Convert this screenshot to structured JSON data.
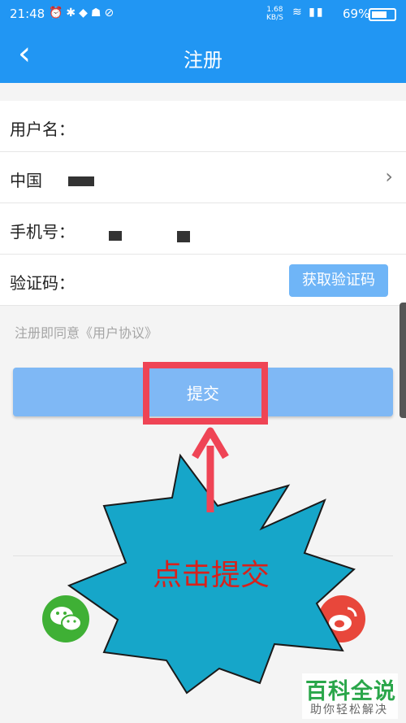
{
  "status_bar": {
    "time": "21:48",
    "net_speed": "1.68",
    "net_unit": "KB/S",
    "battery": "69%",
    "battery_level": 0.69
  },
  "nav": {
    "back_glyph": "‹",
    "title": "注册"
  },
  "form": {
    "username_label": "用户名：",
    "country_label": "中国",
    "phone_label": "手机号：",
    "code_label": "验证码：",
    "get_code_button": "获取验证码"
  },
  "agreement": "注册即同意《用户协议》",
  "submit_label": "提交",
  "annotation": {
    "callout_text": "点击提交"
  },
  "watermark": {
    "title": "百科全说",
    "subtitle": "助你轻松解决"
  },
  "colors": {
    "primary": "#2196f3",
    "button": "#7fb8f5",
    "highlight": "#ef4455",
    "burst": "#16a6c9",
    "callout_text": "#d8211b",
    "wechat": "#3fb035",
    "weibo": "#e8473b"
  },
  "icons": {
    "back": "chevron-left-icon",
    "country_chevron": "chevron-right-icon",
    "wechat": "wechat-icon",
    "weibo": "weibo-icon"
  }
}
